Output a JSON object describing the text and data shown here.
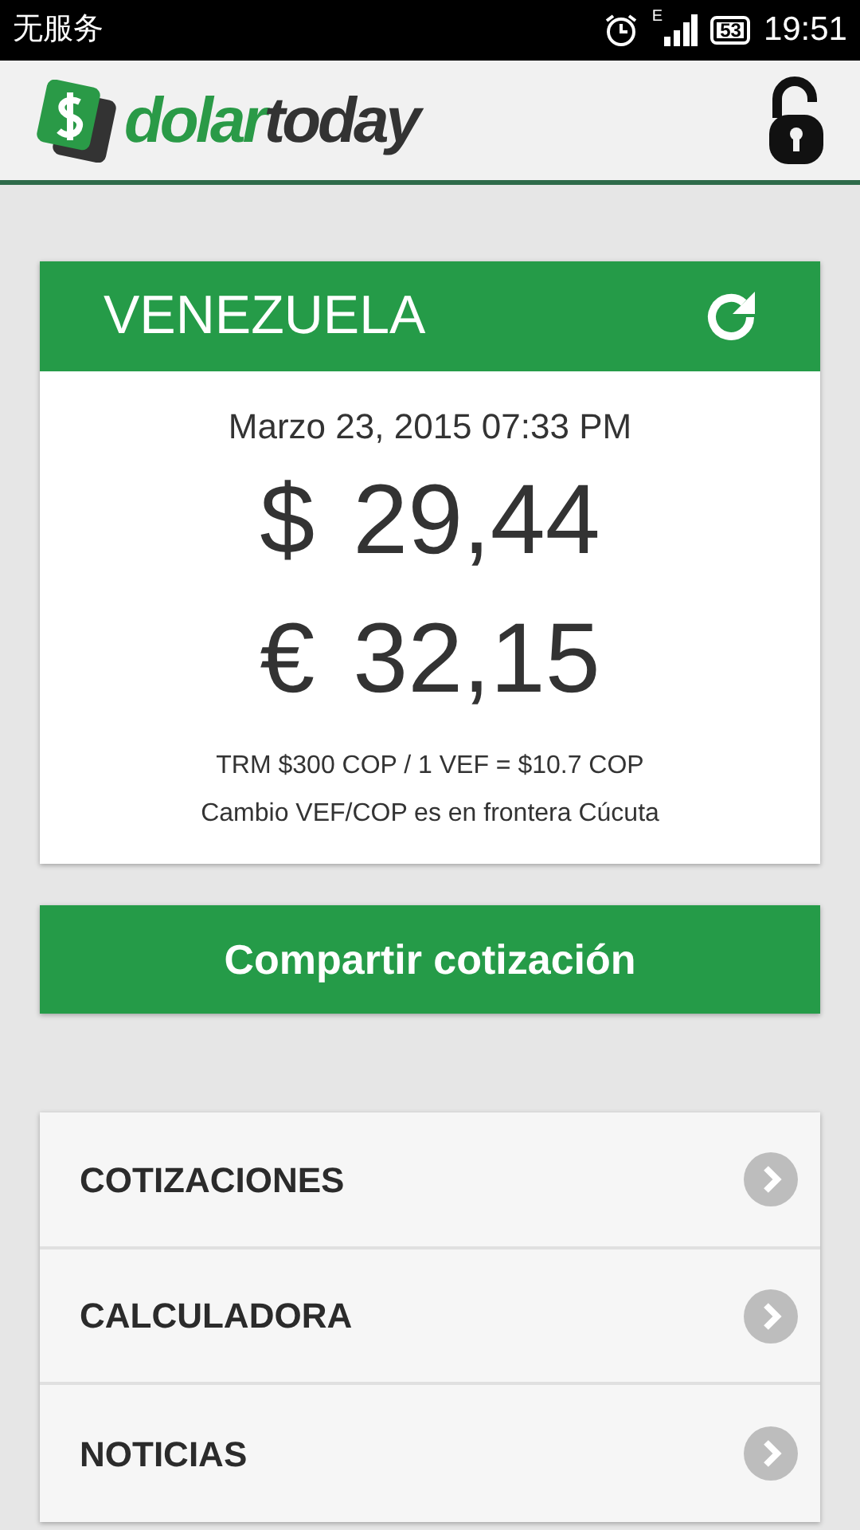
{
  "status_bar": {
    "carrier": "无服务",
    "network": "E",
    "battery": "53",
    "time": "19:51"
  },
  "header": {
    "logo": [
      {
        "text": "dolar",
        "color": "#2a9a47"
      },
      {
        "text": "today",
        "color": "#333333"
      }
    ]
  },
  "rate_card": {
    "country": "VENEZUELA",
    "date": "Marzo 23, 2015 07:33 PM",
    "rates": [
      {
        "symbol": "$",
        "value": "29,44"
      },
      {
        "symbol": "€",
        "value": "32,15"
      }
    ],
    "notes": [
      "TRM $300 COP / 1 VEF = $10.7 COP",
      "Cambio VEF/COP es en frontera Cúcuta"
    ]
  },
  "share_button": "Compartir cotización",
  "menu": [
    {
      "label": "COTIZACIONES"
    },
    {
      "label": "CALCULADORA"
    },
    {
      "label": "NOTICIAS"
    }
  ]
}
